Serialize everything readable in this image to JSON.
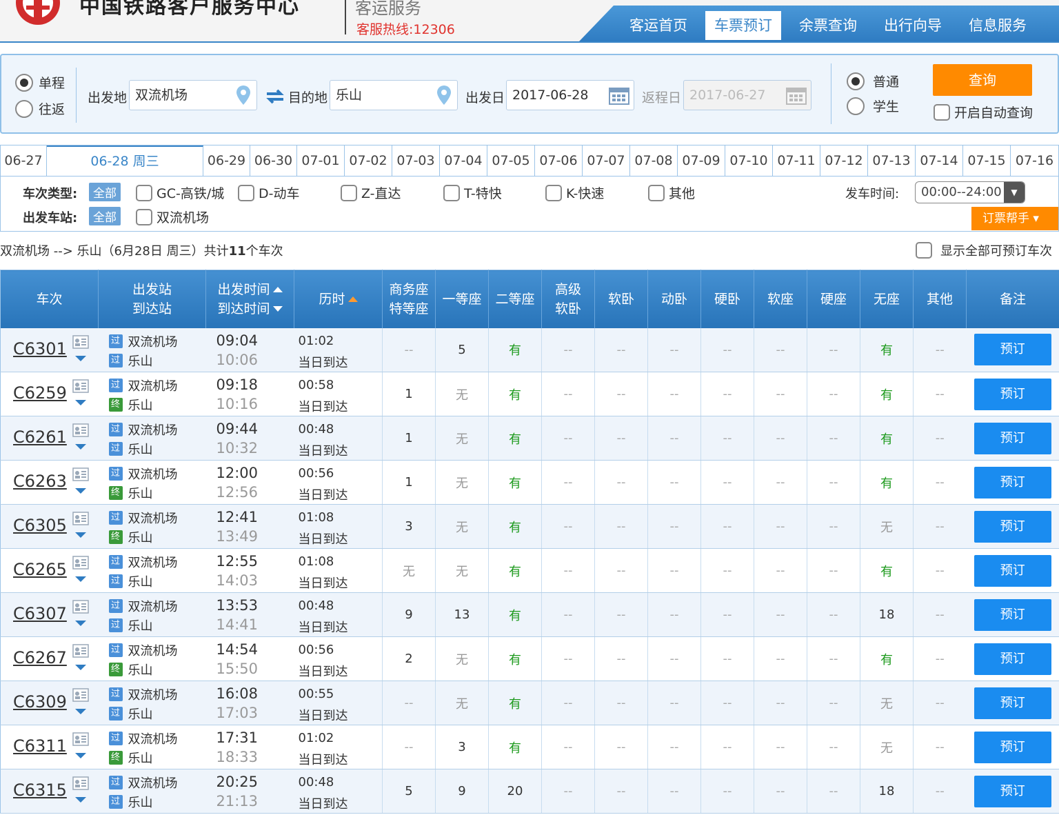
{
  "header": {
    "site_title": "中国铁路客户服务中心",
    "sub_title": "客运服务",
    "hotline": "客服热线:12306",
    "nav": [
      "客运首页",
      "车票预订",
      "余票查询",
      "出行向导",
      "信息服务"
    ],
    "nav_active": 1
  },
  "search": {
    "trip_one_way": "单程",
    "trip_round": "往返",
    "from_label": "出发地",
    "from_value": "双流机场",
    "to_label": "目的地",
    "to_value": "乐山",
    "depart_label": "出发日",
    "depart_value": "2017-06-28",
    "return_label": "返程日",
    "return_value": "2017-06-27",
    "ticket_normal": "普通",
    "ticket_student": "学生",
    "query_button": "查询",
    "auto_query": "开启自动查询"
  },
  "date_tabs": [
    "06-27",
    "06-28 周三",
    "06-29",
    "06-30",
    "07-01",
    "07-02",
    "07-03",
    "07-04",
    "07-05",
    "07-06",
    "07-07",
    "07-08",
    "07-09",
    "07-10",
    "07-11",
    "07-12",
    "07-13",
    "07-14",
    "07-15",
    "07-16"
  ],
  "filters": {
    "type_label": "车次类型:",
    "all": "全部",
    "types": [
      "GC-高铁/城",
      "D-动车",
      "Z-直达",
      "T-特快",
      "K-快速",
      "其他"
    ],
    "station_label": "出发车站:",
    "stations": [
      "双流机场"
    ],
    "time_label": "发车时间:",
    "time_value": "00:00--24:00",
    "helper": "订票帮手"
  },
  "summary": {
    "text": "双流机场 --> 乐山（6月28日  周三）共计",
    "count": "11",
    "suffix": "个车次",
    "show_all": "显示全部可预订车次"
  },
  "table": {
    "headers": {
      "train": "车次",
      "stations_1": "出发站",
      "stations_2": "到达站",
      "times_1": "出发时间",
      "times_2": "到达时间",
      "duration": "历时",
      "biz_1": "商务座",
      "biz_2": "特等座",
      "first": "一等座",
      "second": "二等座",
      "hsoft_1": "高级",
      "hsoft_2": "软卧",
      "soft_sleeper": "软卧",
      "dong_sleeper": "动卧",
      "hard_sleeper": "硬卧",
      "soft_seat": "软座",
      "hard_seat": "硬座",
      "no_seat": "无座",
      "other": "其他",
      "note": "备注"
    },
    "badges": {
      "pass": "过",
      "end": "终"
    },
    "same_day": "当日到达",
    "book_label": "预订",
    "rows": [
      {
        "train": "C6301",
        "from": "双流机场",
        "to": "乐山",
        "to_badge": "pass",
        "dep": "09:04",
        "arr": "10:06",
        "dur": "01:02",
        "seats": [
          "--",
          "5",
          "有",
          "--",
          "--",
          "--",
          "--",
          "--",
          "--",
          "有",
          "--"
        ]
      },
      {
        "train": "C6259",
        "from": "双流机场",
        "to": "乐山",
        "to_badge": "end",
        "dep": "09:18",
        "arr": "10:16",
        "dur": "00:58",
        "seats": [
          "1",
          "无",
          "有",
          "--",
          "--",
          "--",
          "--",
          "--",
          "--",
          "有",
          "--"
        ]
      },
      {
        "train": "C6261",
        "from": "双流机场",
        "to": "乐山",
        "to_badge": "pass",
        "dep": "09:44",
        "arr": "10:32",
        "dur": "00:48",
        "seats": [
          "1",
          "无",
          "有",
          "--",
          "--",
          "--",
          "--",
          "--",
          "--",
          "有",
          "--"
        ]
      },
      {
        "train": "C6263",
        "from": "双流机场",
        "to": "乐山",
        "to_badge": "end",
        "dep": "12:00",
        "arr": "12:56",
        "dur": "00:56",
        "seats": [
          "1",
          "无",
          "有",
          "--",
          "--",
          "--",
          "--",
          "--",
          "--",
          "有",
          "--"
        ]
      },
      {
        "train": "C6305",
        "from": "双流机场",
        "to": "乐山",
        "to_badge": "end",
        "dep": "12:41",
        "arr": "13:49",
        "dur": "01:08",
        "seats": [
          "3",
          "无",
          "有",
          "--",
          "--",
          "--",
          "--",
          "--",
          "--",
          "无",
          "--"
        ]
      },
      {
        "train": "C6265",
        "from": "双流机场",
        "to": "乐山",
        "to_badge": "pass",
        "dep": "12:55",
        "arr": "14:03",
        "dur": "01:08",
        "seats": [
          "无",
          "无",
          "有",
          "--",
          "--",
          "--",
          "--",
          "--",
          "--",
          "有",
          "--"
        ]
      },
      {
        "train": "C6307",
        "from": "双流机场",
        "to": "乐山",
        "to_badge": "pass",
        "dep": "13:53",
        "arr": "14:41",
        "dur": "00:48",
        "seats": [
          "9",
          "13",
          "有",
          "--",
          "--",
          "--",
          "--",
          "--",
          "--",
          "18",
          "--"
        ]
      },
      {
        "train": "C6267",
        "from": "双流机场",
        "to": "乐山",
        "to_badge": "end",
        "dep": "14:54",
        "arr": "15:50",
        "dur": "00:56",
        "seats": [
          "2",
          "无",
          "有",
          "--",
          "--",
          "--",
          "--",
          "--",
          "--",
          "有",
          "--"
        ]
      },
      {
        "train": "C6309",
        "from": "双流机场",
        "to": "乐山",
        "to_badge": "pass",
        "dep": "16:08",
        "arr": "17:03",
        "dur": "00:55",
        "seats": [
          "--",
          "无",
          "有",
          "--",
          "--",
          "--",
          "--",
          "--",
          "--",
          "无",
          "--"
        ]
      },
      {
        "train": "C6311",
        "from": "双流机场",
        "to": "乐山",
        "to_badge": "end",
        "dep": "17:31",
        "arr": "18:33",
        "dur": "01:02",
        "seats": [
          "--",
          "3",
          "有",
          "--",
          "--",
          "--",
          "--",
          "--",
          "--",
          "无",
          "--"
        ]
      },
      {
        "train": "C6315",
        "from": "双流机场",
        "to": "乐山",
        "to_badge": "pass",
        "dep": "20:25",
        "arr": "21:13",
        "dur": "00:48",
        "seats": [
          "5",
          "9",
          "20",
          "--",
          "--",
          "--",
          "--",
          "--",
          "--",
          "18",
          "--"
        ]
      }
    ]
  }
}
